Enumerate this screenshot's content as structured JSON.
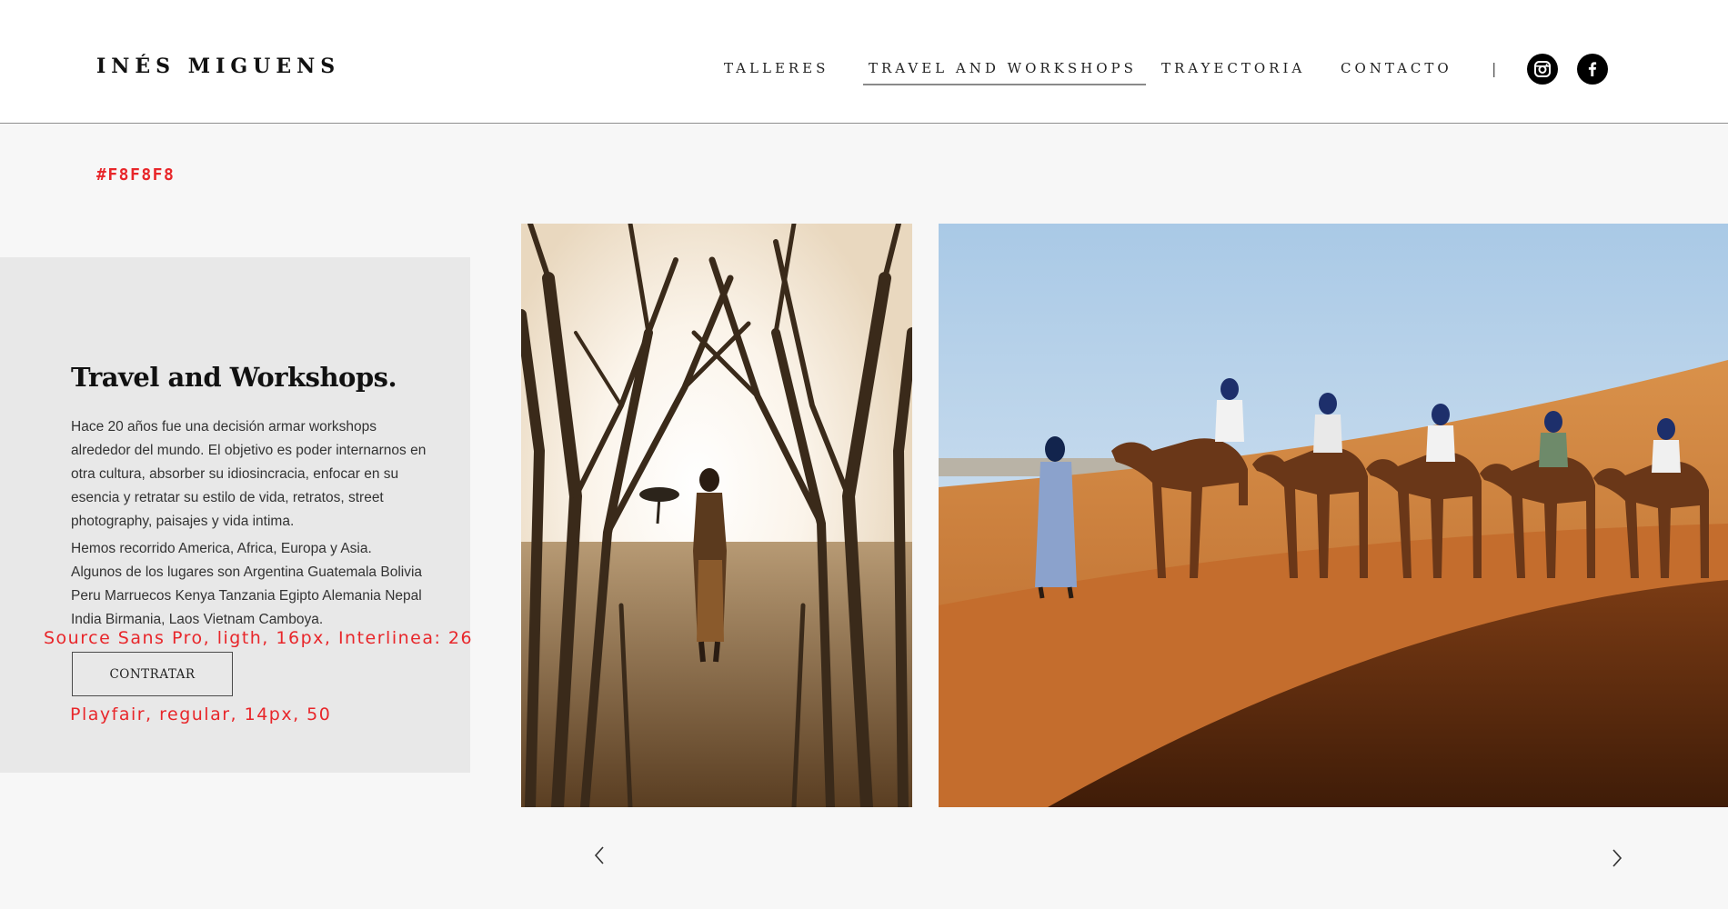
{
  "header": {
    "logo": "INÉS MIGUENS",
    "nav": [
      {
        "label": "TALLERES"
      },
      {
        "label": "TRAVEL AND WORKSHOPS"
      },
      {
        "label": "TRAYECTORIA"
      },
      {
        "label": "CONTACTO"
      }
    ],
    "separator": "|",
    "social": [
      "instagram-icon",
      "facebook-icon"
    ]
  },
  "annotations": {
    "background_hex": "#F8F8F8",
    "body_font": "Source Sans Pro, ligth, 16px, Interlinea: 26",
    "button_font": "Playfair, regular, 14px, 50"
  },
  "panel": {
    "title": "Travel and Workshops.",
    "paragraph1": "Hace 20 años fue una decisión armar workshops alrededor del mundo. El objetivo es poder internarnos en otra cultura, absorber su idiosincracia, enfocar en su esencia y retratar su estilo de vida, retratos, street photography, paisajes y vida intima.",
    "paragraph2": "Hemos recorrido America, Africa, Europa y Asia.",
    "paragraph3": "Algunos de los lugares son Argentina Guatemala Bolivia Peru Marruecos Kenya Tanzania Egipto Alemania Nepal India Birmania, Laos Vietnam Camboya.",
    "button": "CONTRATAR"
  },
  "gallery": {
    "arrows": [
      "chevron-left-icon",
      "chevron-right-icon"
    ]
  },
  "colors": {
    "page_bg": "#F8F8F8",
    "panel_bg": "#E8E8E8",
    "annotation": "#E8262A",
    "active_underline": "#8A8A8A"
  }
}
